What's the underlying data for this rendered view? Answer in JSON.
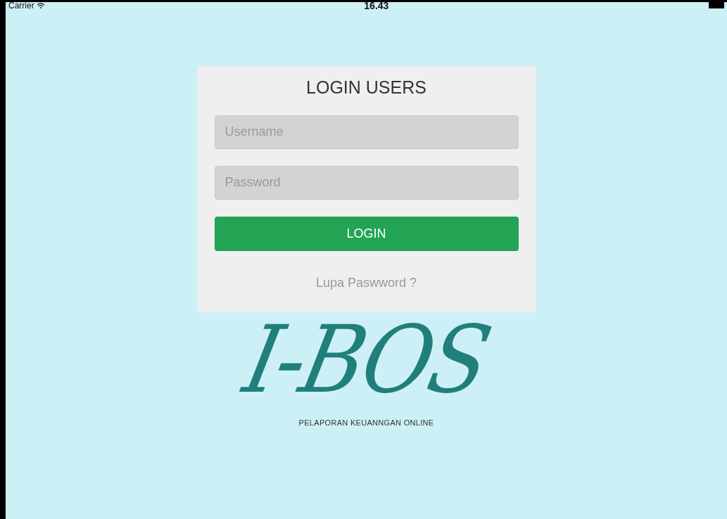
{
  "status_bar": {
    "carrier": "Carrier",
    "time": "16.43"
  },
  "login": {
    "title": "LOGIN USERS",
    "username": {
      "placeholder": "Username"
    },
    "password": {
      "placeholder": "Password"
    },
    "button": "LOGIN",
    "forgot_link": "Lupa Paswword ?"
  },
  "logo": {
    "text": "I-BOS",
    "tagline": "PELAPORAN KEUANNGAN ONLINE"
  }
}
